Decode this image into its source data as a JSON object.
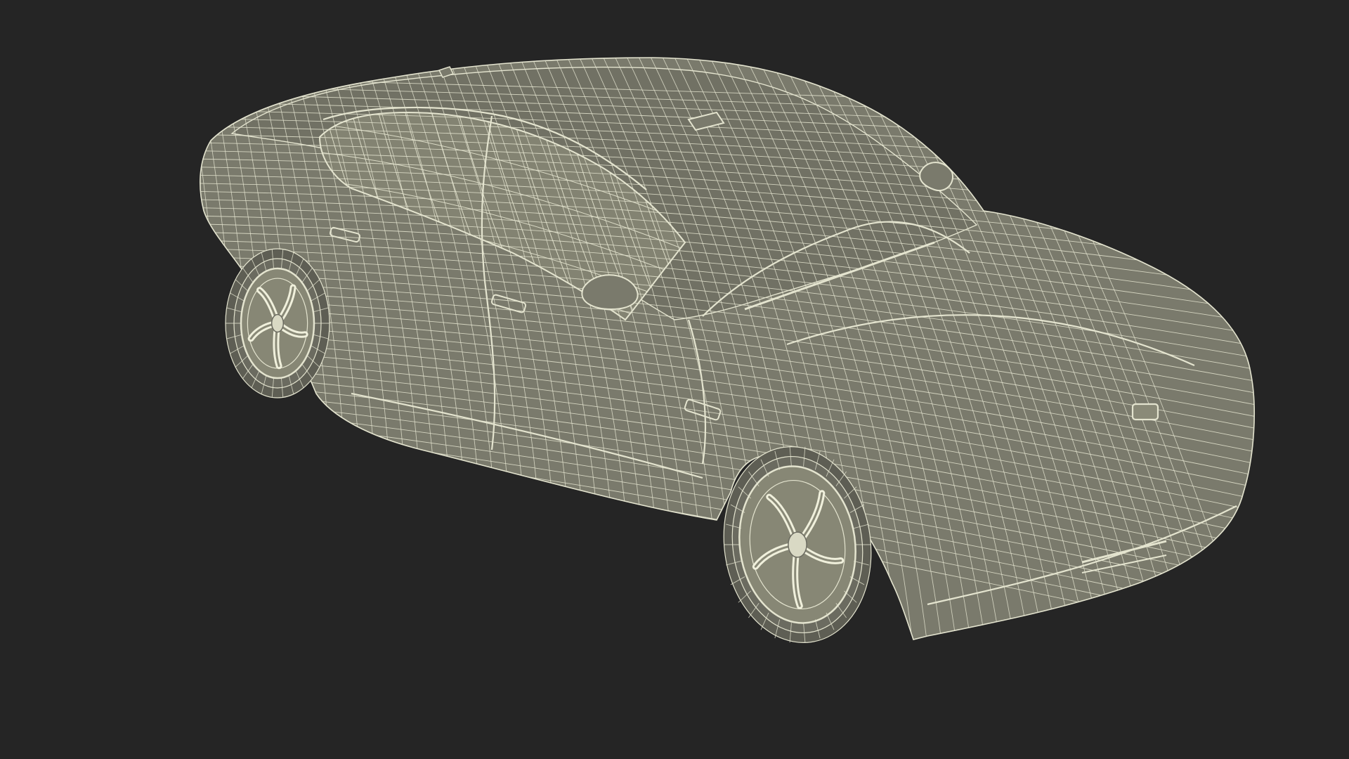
{
  "scene": {
    "background_color": "#252525",
    "model_fill_color": "#7a7a6c",
    "model_shade_color": "#6a6a5e",
    "wire_color": "#e4e4cf",
    "glass_color": "#838372"
  }
}
